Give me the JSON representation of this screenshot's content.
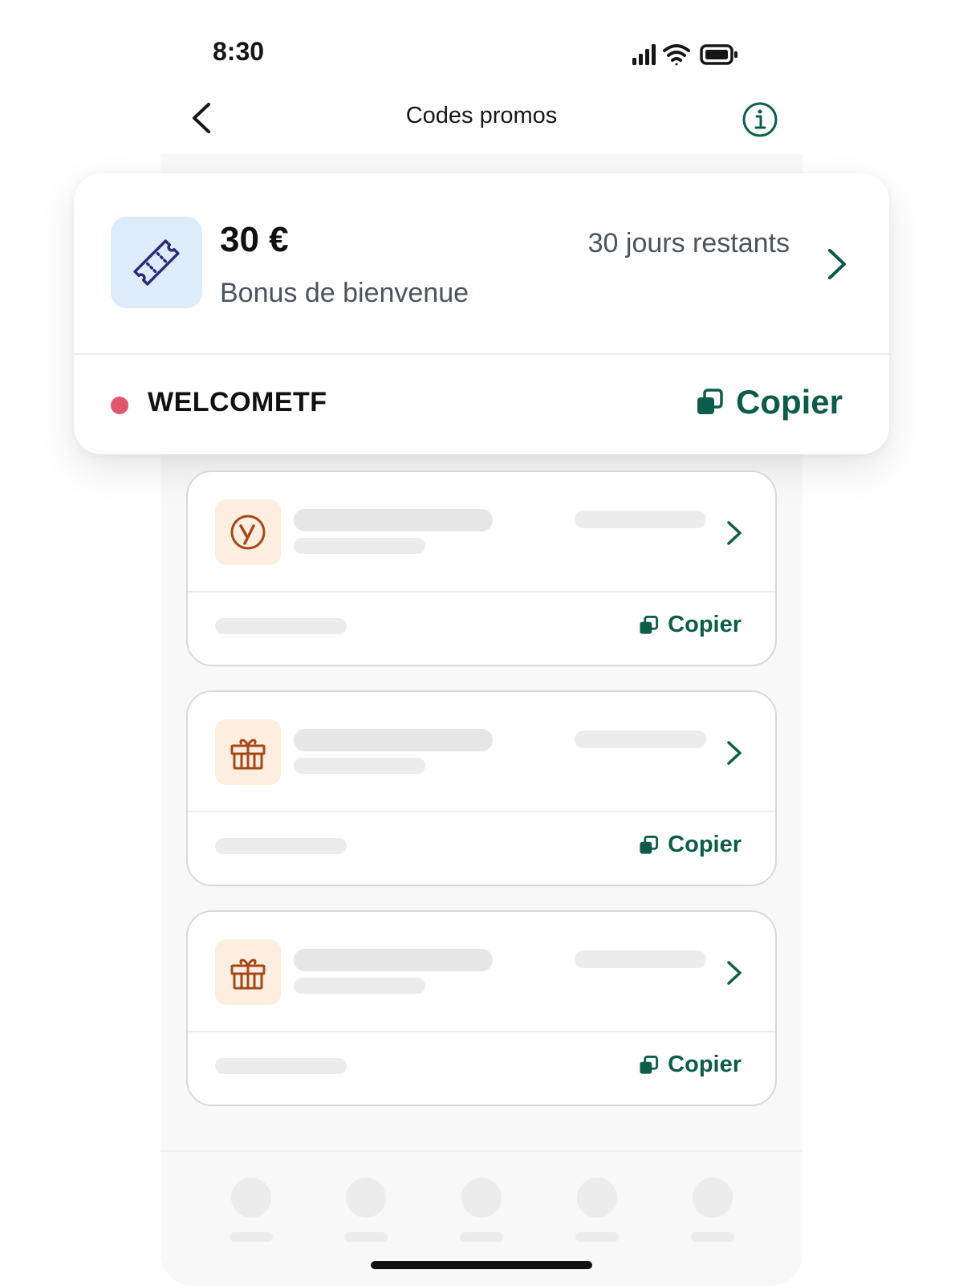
{
  "status_bar": {
    "time": "8:30",
    "icons": [
      "cellular-signal-icon",
      "wifi-icon",
      "battery-icon"
    ]
  },
  "header": {
    "title": "Codes promos",
    "back_icon": "chevron-left-icon",
    "info_icon": "info-circle-icon"
  },
  "featured_promo": {
    "icon": "ticket-icon",
    "amount": "30 €",
    "label": "Bonus de bienvenue",
    "days_remaining": "30 jours restants",
    "status_color": "#e2566d",
    "code": "WELCOMETF",
    "copy_label": "Copier"
  },
  "promo_list": [
    {
      "icon": "brand-y-icon",
      "copy_label": "Copier"
    },
    {
      "icon": "gift-icon",
      "copy_label": "Copier"
    },
    {
      "icon": "gift-icon",
      "copy_label": "Copier"
    }
  ],
  "colors": {
    "accent": "#0c5c4a",
    "ticket_icon": "#2e2a7a",
    "brand_icon": "#a4481a",
    "featured_icon_bg": "#deebfa",
    "promo_icon_bg": "#fdeee0"
  }
}
